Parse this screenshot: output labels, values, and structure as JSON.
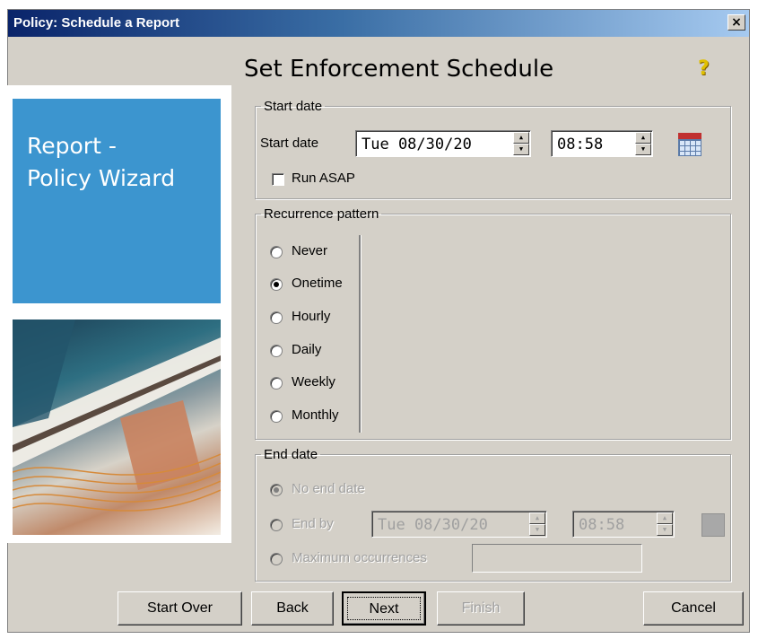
{
  "window": {
    "title": "Policy: Schedule a Report",
    "close_label": "×"
  },
  "side": {
    "line1": "Report -",
    "line2": "Policy Wizard",
    "accent": "#3c95cf"
  },
  "heading": "Set Enforcement Schedule",
  "help_icon": "?",
  "start": {
    "legend": "Start date",
    "label": "Start date",
    "date_value": "Tue   08/30/20",
    "time_value": "08:58",
    "run_asap_label": "Run ASAP",
    "run_asap_checked": false
  },
  "recurrence": {
    "legend": "Recurrence pattern",
    "selected": "Onetime",
    "options": [
      "Never",
      "Onetime",
      "Hourly",
      "Daily",
      "Weekly",
      "Monthly"
    ]
  },
  "end": {
    "legend": "End date",
    "no_end_label": "No end date",
    "end_by_label": "End by",
    "date_value": "Tue   08/30/20",
    "time_value": "08:58",
    "max_label": "Maximum occurrences"
  },
  "buttons": {
    "start_over": "Start Over",
    "back": "Back",
    "next": "Next",
    "finish": "Finish",
    "cancel": "Cancel"
  }
}
